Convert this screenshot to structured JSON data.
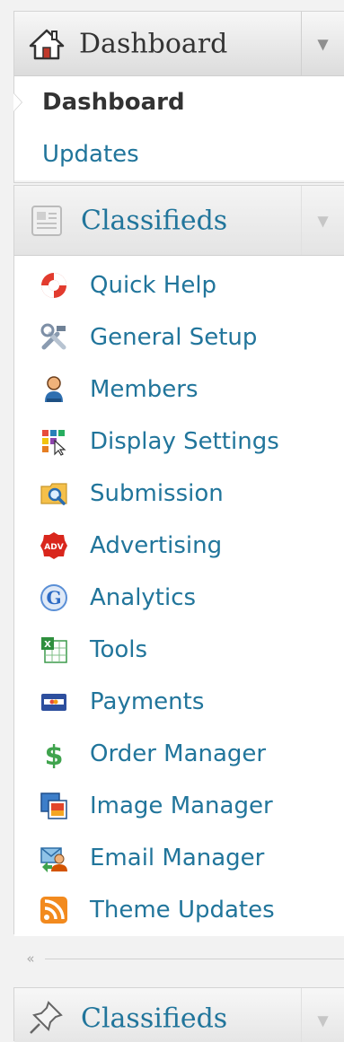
{
  "dashboard": {
    "title": "Dashboard",
    "toggle_icon": "triangle-down-icon",
    "submenu": [
      {
        "label": "Dashboard",
        "current": true
      },
      {
        "label": "Updates",
        "current": false
      }
    ]
  },
  "classifieds": {
    "title": "Classifieds",
    "toggle_icon": "triangle-down-icon",
    "items": [
      {
        "label": "Quick Help",
        "icon": "lifebuoy-icon"
      },
      {
        "label": "General Setup",
        "icon": "tools-icon"
      },
      {
        "label": "Members",
        "icon": "user-icon"
      },
      {
        "label": "Display Settings",
        "icon": "color-grid-icon"
      },
      {
        "label": "Submission",
        "icon": "folder-search-icon"
      },
      {
        "label": "Advertising",
        "icon": "adv-badge-icon"
      },
      {
        "label": "Analytics",
        "icon": "google-g-icon"
      },
      {
        "label": "Tools",
        "icon": "spreadsheet-icon"
      },
      {
        "label": "Payments",
        "icon": "credit-card-icon"
      },
      {
        "label": "Order Manager",
        "icon": "dollar-icon"
      },
      {
        "label": "Image Manager",
        "icon": "images-icon"
      },
      {
        "label": "Email Manager",
        "icon": "email-user-icon"
      },
      {
        "label": "Theme Updates",
        "icon": "rss-icon"
      }
    ]
  },
  "collapse_menu": {
    "icon": "double-chevron-left-icon",
    "glyph": "«"
  },
  "bottom_panel": {
    "title": "Classifieds",
    "icon": "pin-icon"
  }
}
